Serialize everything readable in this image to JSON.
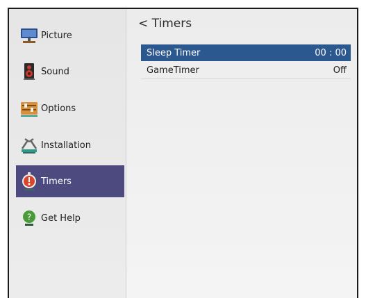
{
  "sidebar": {
    "items": [
      {
        "label": "Picture",
        "icon": "monitor-icon"
      },
      {
        "label": "Sound",
        "icon": "speaker-icon"
      },
      {
        "label": "Options",
        "icon": "options-panel-icon"
      },
      {
        "label": "Installation",
        "icon": "tools-icon"
      },
      {
        "label": "Timers",
        "icon": "stopwatch-icon",
        "selected": true
      },
      {
        "label": "Get Help",
        "icon": "help-icon"
      }
    ]
  },
  "main": {
    "title": "< Timers",
    "rows": [
      {
        "label": "Sleep Timer",
        "value": "00 : 00",
        "highlighted": true
      },
      {
        "label": "GameTimer",
        "value": "Off",
        "highlighted": false
      }
    ]
  },
  "colors": {
    "selected_bg": "#4c4a7e",
    "highlight_bg": "#2c5890"
  }
}
